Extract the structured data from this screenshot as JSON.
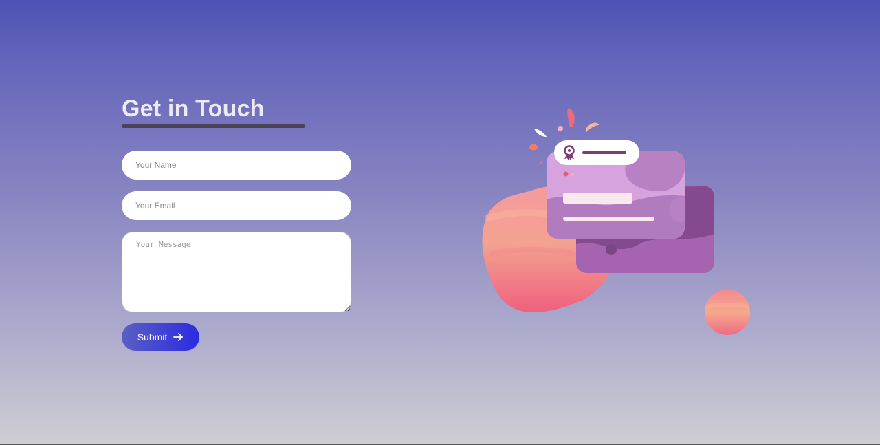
{
  "contact": {
    "title": "Get in Touch",
    "name_placeholder": "Your Name",
    "email_placeholder": "Your Email",
    "message_placeholder": "Your Message",
    "submit_label": "Submit",
    "submit_icon": "arrow-right-icon"
  },
  "illustration": {
    "badge_icon": "award-ribbon-icon"
  },
  "colors": {
    "accent": "#2b2be0",
    "title": "#ecebf3",
    "underline": "#4a4256",
    "card_light": "#d9a6e0",
    "card_dark": "#a062ad",
    "blob_pink": "#f06c88",
    "blob_peach": "#f4a894"
  }
}
